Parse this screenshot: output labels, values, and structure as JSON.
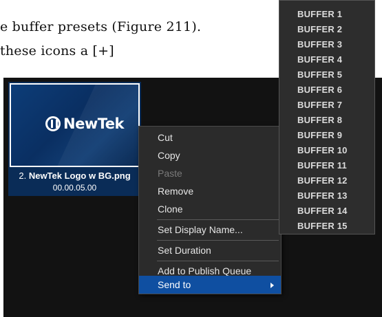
{
  "document": {
    "line1": "e buffer presets (Figure 211).",
    "line2": " these icons a [+]"
  },
  "thumbnail": {
    "logo_text": "NewTek",
    "name_prefix": "2. ",
    "name": "NewTek Logo w BG.png",
    "duration": "00.00.05.00"
  },
  "context_menu": {
    "items": [
      {
        "label": "Cut",
        "state": "enabled"
      },
      {
        "label": "Copy",
        "state": "enabled"
      },
      {
        "label": "Paste",
        "state": "disabled"
      },
      {
        "label": "Remove",
        "state": "enabled"
      },
      {
        "label": "Clone",
        "state": "enabled"
      },
      {
        "label": "Set Display Name...",
        "state": "enabled"
      },
      {
        "label": "Set Duration",
        "state": "enabled"
      },
      {
        "label": "Add to Publish Queue",
        "state": "enabled"
      },
      {
        "label": "Send to",
        "state": "selected",
        "submenu_icon": "chevron-right-icon"
      }
    ]
  },
  "buffer_submenu": {
    "items": [
      "BUFFER 1",
      "BUFFER 2",
      "BUFFER 3",
      "BUFFER 4",
      "BUFFER 5",
      "BUFFER 6",
      "BUFFER 7",
      "BUFFER 8",
      "BUFFER 9",
      "BUFFER 10",
      "BUFFER 11",
      "BUFFER 12",
      "BUFFER 13",
      "BUFFER 14",
      "BUFFER 15"
    ]
  },
  "colors": {
    "screen_bg": "#121212",
    "thumb_bg": "#0a2c57",
    "menu_bg": "#2b2b2b",
    "selected_bg": "#0f4fa1"
  }
}
